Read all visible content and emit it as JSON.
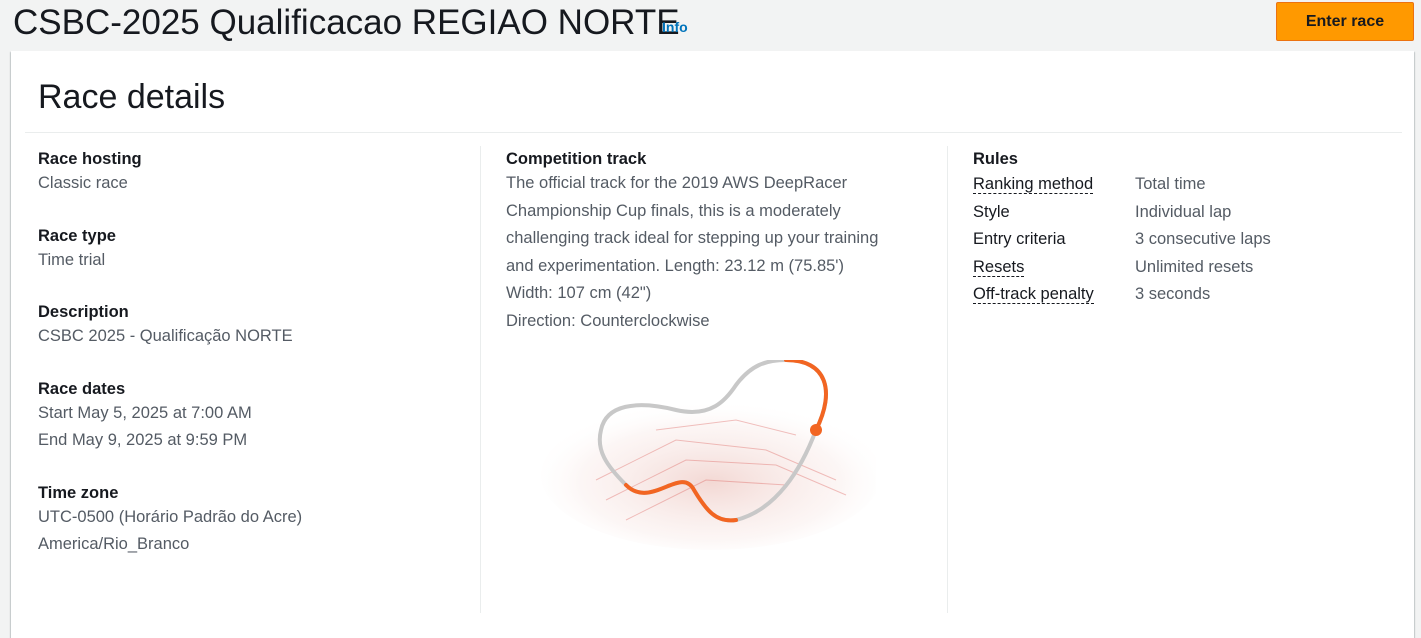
{
  "header": {
    "title": "CSBC-2025 Qualificacao REGIAO NORTE",
    "info_label": "Info",
    "enter_button": "Enter race"
  },
  "panel": {
    "title": "Race details"
  },
  "details": {
    "race_hosting": {
      "label": "Race hosting",
      "value": "Classic race"
    },
    "race_type": {
      "label": "Race type",
      "value": "Time trial"
    },
    "description": {
      "label": "Description",
      "value": "CSBC 2025 - Qualificação NORTE"
    },
    "race_dates": {
      "label": "Race dates",
      "start": "Start May 5, 2025 at 7:00 AM",
      "end": "End May 9, 2025 at 9:59 PM"
    },
    "time_zone": {
      "label": "Time zone",
      "offset": "UTC-0500 (Horário Padrão do Acre)",
      "region": "America/Rio_Branco"
    }
  },
  "track": {
    "label": "Competition track",
    "desc_lines": [
      "The official track for the 2019 AWS DeepRacer",
      "Championship Cup finals, this is a moderately",
      "challenging track ideal for stepping up your training",
      "and experimentation. Length: 23.12 m (75.85')",
      "Width: 107 cm (42\")",
      "Direction: Counterclockwise"
    ],
    "colors": {
      "accent": "#f26522",
      "base": "#c8c8c8"
    }
  },
  "rules": {
    "label": "Rules",
    "items": [
      {
        "key": "Ranking method",
        "value": "Total time"
      },
      {
        "key": "Style",
        "value": "Individual lap"
      },
      {
        "key": "Entry criteria",
        "value": "3 consecutive laps"
      },
      {
        "key": "Resets",
        "value": "Unlimited resets"
      },
      {
        "key": "Off-track penalty",
        "value": "3 seconds"
      }
    ]
  },
  "colors": {
    "primary_button": "#ff9900",
    "link": "#0073bb",
    "background": "#f2f3f3"
  }
}
